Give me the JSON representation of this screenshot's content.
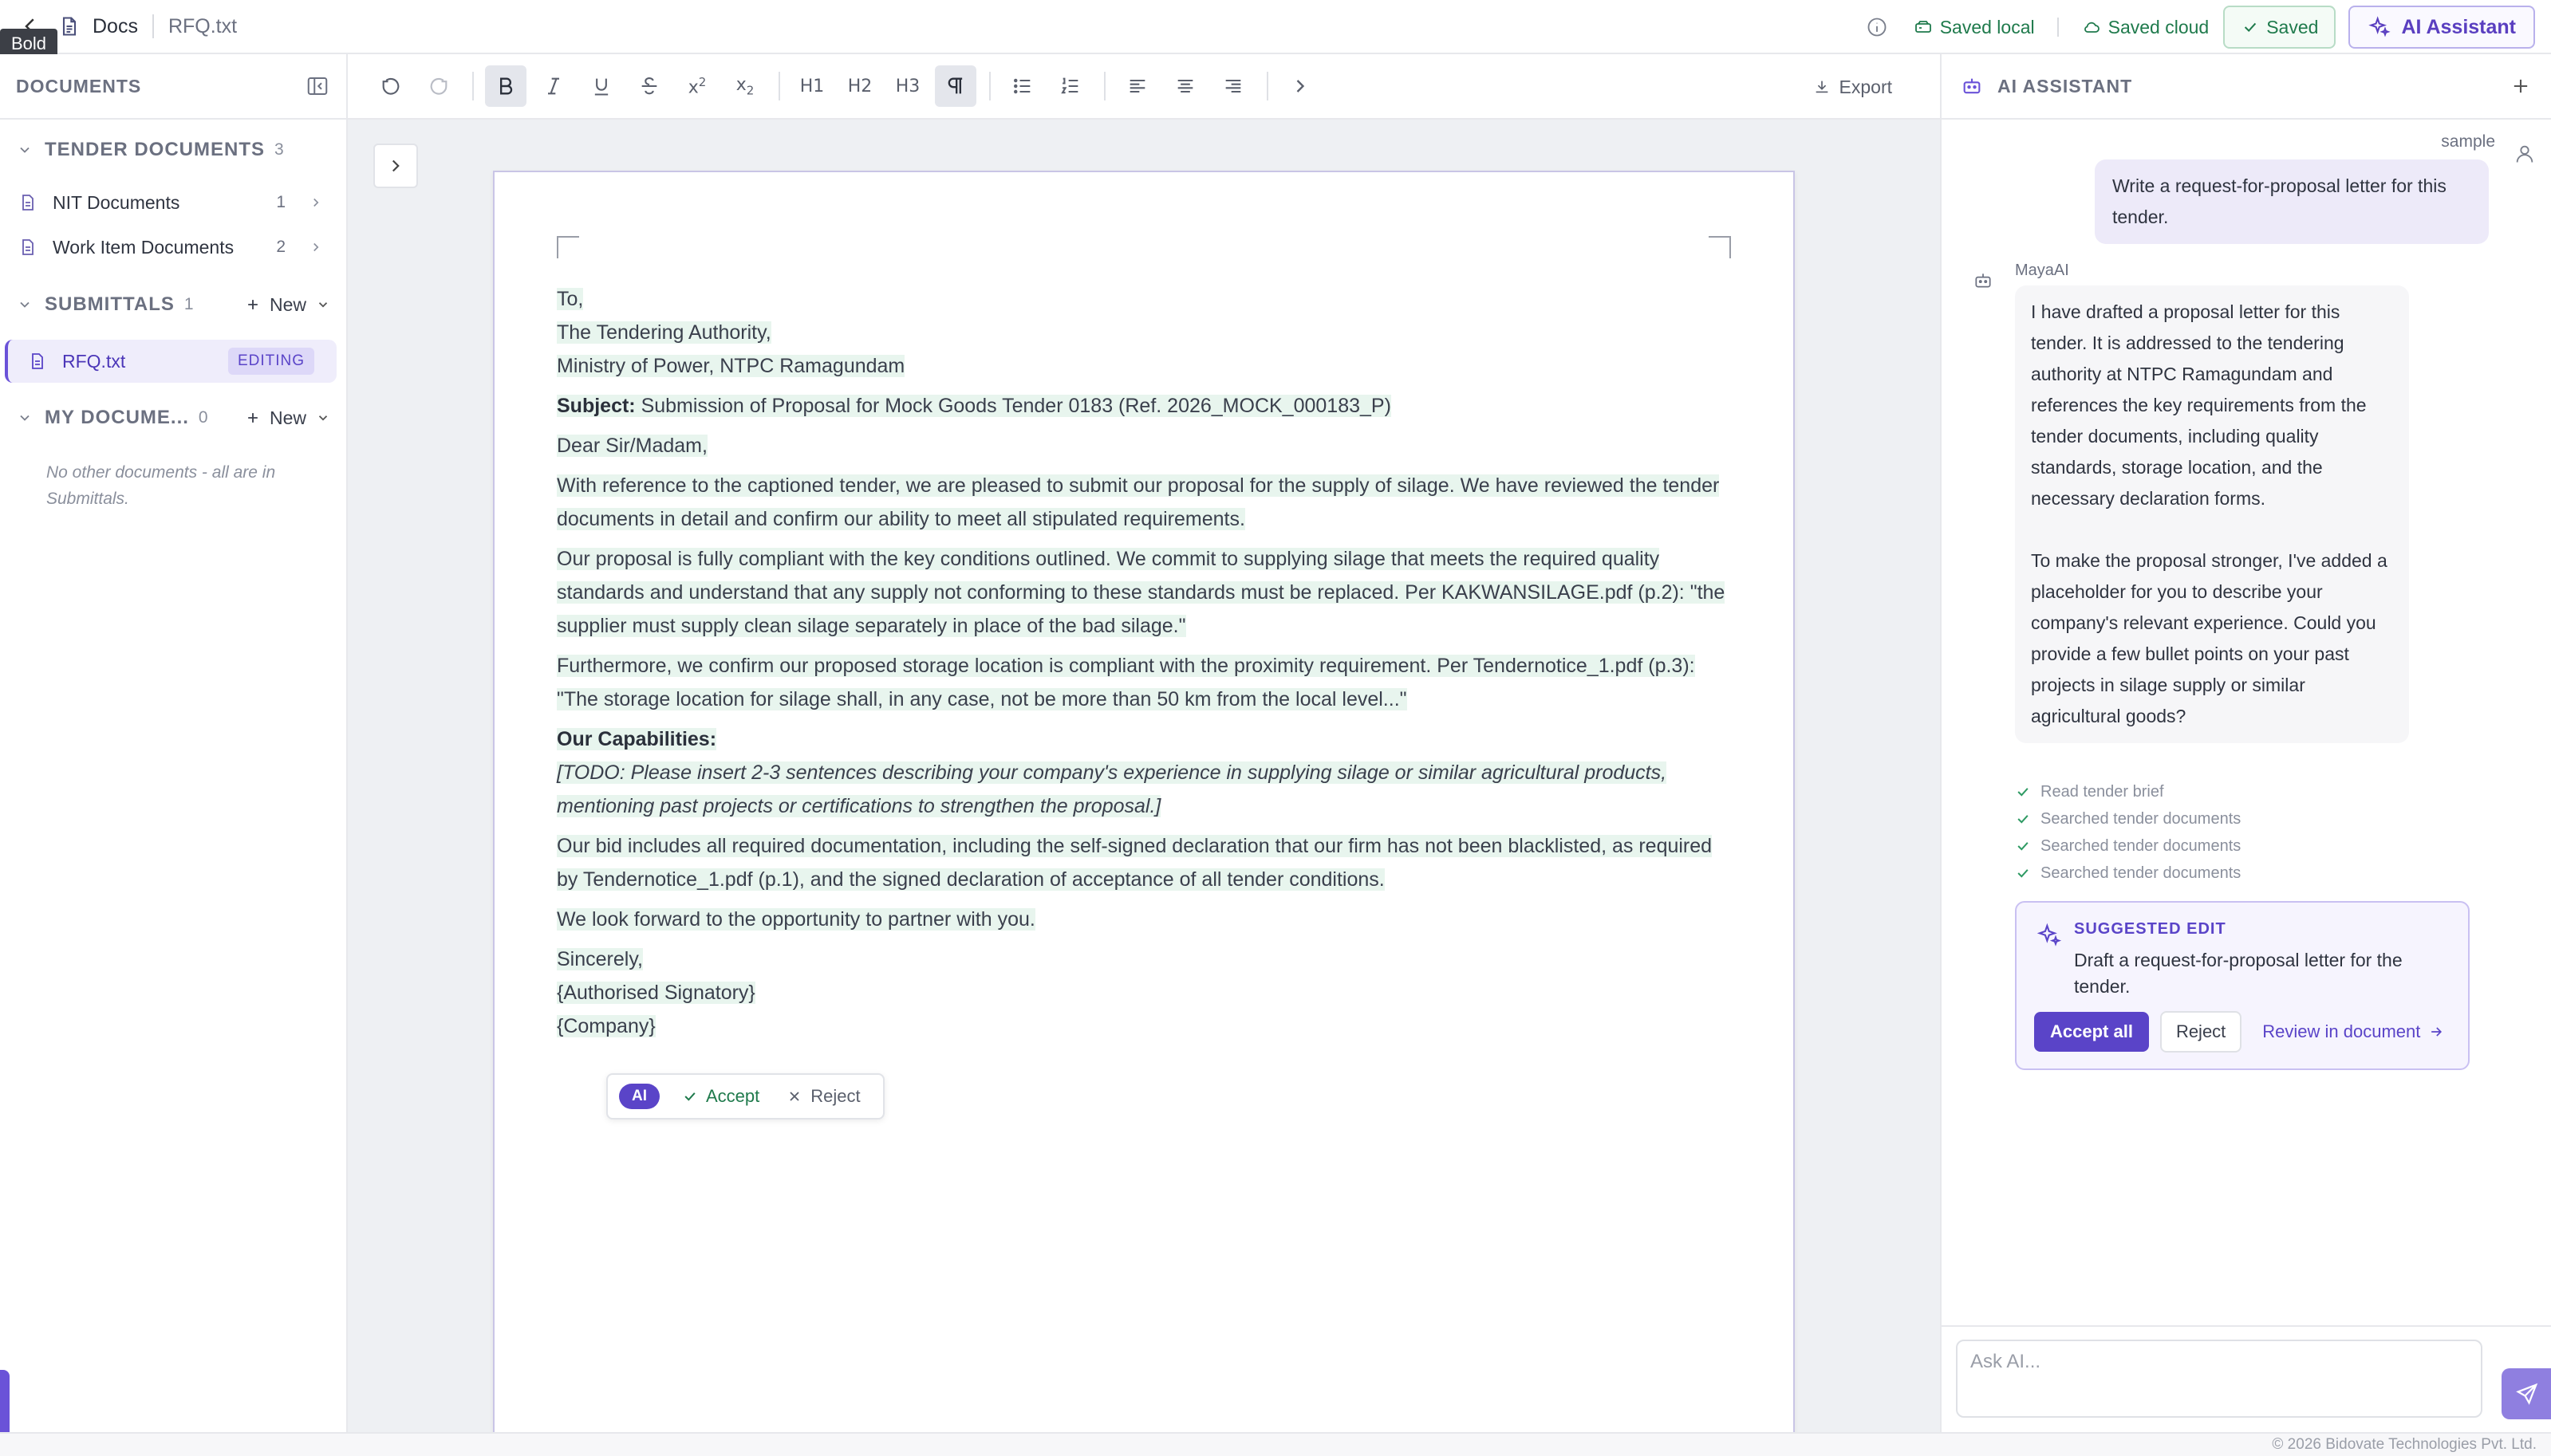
{
  "topbar": {
    "docs_label": "Docs",
    "file_name": "RFQ.txt",
    "tooltip": "Bold",
    "saved_local": "Saved local",
    "saved_cloud": "Saved cloud",
    "saved": "Saved",
    "ai_assistant": "AI Assistant"
  },
  "sidebar": {
    "title": "DOCUMENTS",
    "tender": {
      "title": "TENDER DOCUMENTS",
      "count": "3",
      "items": [
        {
          "label": "NIT Documents",
          "count": "1"
        },
        {
          "label": "Work Item Documents",
          "count": "2"
        }
      ]
    },
    "submittals": {
      "title": "SUBMITTALS",
      "count": "1",
      "new_label": "New",
      "items": [
        {
          "label": "RFQ.txt",
          "badge": "EDITING"
        }
      ]
    },
    "my_documents": {
      "title": "MY DOCUME...",
      "count": "0",
      "new_label": "New",
      "empty_note": "No other documents - all are in Submittals."
    }
  },
  "toolbar": {
    "h1": "H1",
    "h2": "H2",
    "h3": "H3",
    "export": "Export"
  },
  "document": {
    "to": "To,",
    "addr1": "The Tendering Authority,",
    "addr2": "Ministry of Power, NTPC Ramagundam",
    "subject_label": "Subject:",
    "subject_text": " Submission of Proposal for Mock Goods Tender 0183 (Ref. 2026_MOCK_000183_P)",
    "salutation": "Dear Sir/Madam,",
    "para1": "With reference to the captioned tender, we are pleased to submit our proposal for the supply of silage. We have reviewed the tender documents in detail and confirm our ability to meet all stipulated requirements.",
    "para2": "Our proposal is fully compliant with the key conditions outlined. We commit to supplying silage that meets the required quality standards and understand that any supply not conforming to these standards must be replaced. Per KAKWANSILAGE.pdf (p.2): \"the supplier must supply clean silage separately in place of the bad silage.\"",
    "para3": "Furthermore, we confirm our proposed storage location is compliant with the proximity requirement. Per Tendernotice_1.pdf (p.3): \"The storage location for silage shall, in any case, not be more than 50 km from the local level...\"",
    "capabilities_heading": "Our Capabilities:",
    "todo": "[TODO: Please insert 2-3 sentences describing your company's experience in supplying silage or similar agricultural products, mentioning past projects or certifications to strengthen the proposal.]",
    "para4": "Our bid includes all required documentation, including the self-signed declaration that our firm has not been blacklisted, as required by Tendernotice_1.pdf (p.1), and the signed declaration of acceptance of all tender conditions.",
    "para5": "We look forward to the opportunity to partner with you.",
    "closing": "Sincerely,",
    "signatory": "{Authorised Signatory}",
    "company": "{Company}"
  },
  "suggestion_bar": {
    "ai": "AI",
    "accept": "Accept",
    "reject": "Reject"
  },
  "ai_panel": {
    "title": "AI ASSISTANT",
    "user_name": "sample",
    "user_message": "Write a request-for-proposal letter for this tender.",
    "bot_name": "MayaAI",
    "bot_message_1": "I have drafted a proposal letter for this tender. It is addressed to the tendering authority at NTPC Ramagundam and references the key requirements from the tender documents, including quality standards, storage location, and the necessary declaration forms.",
    "bot_message_2": "To make the proposal stronger, I've added a placeholder for you to describe your company's relevant experience. Could you provide a few bullet points on your past projects in silage supply or similar agricultural goods?",
    "steps": [
      "Read tender brief",
      "Searched tender documents",
      "Searched tender documents",
      "Searched tender documents"
    ],
    "suggested_edit": {
      "label": "SUGGESTED EDIT",
      "description": "Draft a request-for-proposal letter for the tender.",
      "accept_all": "Accept all",
      "reject": "Reject",
      "review": "Review in document"
    },
    "ask_placeholder": "Ask AI..."
  },
  "footer": {
    "copyright": "© 2026 Bidovate Technologies Pvt. Ltd."
  },
  "colors": {
    "accent": "#5a44c8",
    "success": "#1f7a4c",
    "highlight": "#e8f5ee"
  }
}
